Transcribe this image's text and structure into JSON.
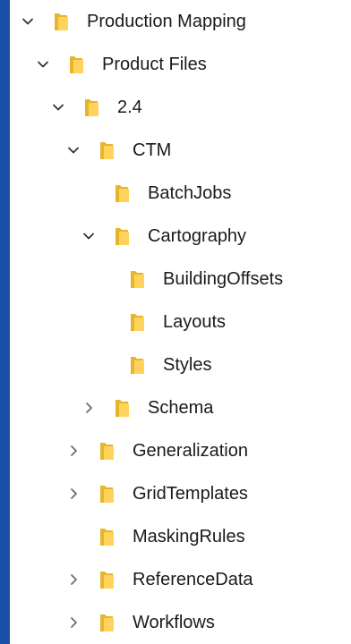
{
  "colors": {
    "backdrop": "#1a4fa8",
    "panel": "#ffffff",
    "text": "#1a1a1a",
    "chevron": "#6e6e6e",
    "folder_back": "#e6b52b",
    "folder_front": "#ffd35c"
  },
  "tree": {
    "items": [
      {
        "label": "Production Mapping",
        "level": 0,
        "state": "expanded"
      },
      {
        "label": "Product Files",
        "level": 1,
        "state": "expanded"
      },
      {
        "label": "2.4",
        "level": 2,
        "state": "expanded"
      },
      {
        "label": "CTM",
        "level": 3,
        "state": "expanded"
      },
      {
        "label": "BatchJobs",
        "level": 4,
        "state": "leaf"
      },
      {
        "label": "Cartography",
        "level": 4,
        "state": "expanded"
      },
      {
        "label": "BuildingOffsets",
        "level": 5,
        "state": "leaf"
      },
      {
        "label": "Layouts",
        "level": 5,
        "state": "leaf"
      },
      {
        "label": "Styles",
        "level": 5,
        "state": "leaf"
      },
      {
        "label": "Schema",
        "level": 4,
        "state": "collapsed"
      },
      {
        "label": "Generalization",
        "level": 3,
        "state": "collapsed"
      },
      {
        "label": "GridTemplates",
        "level": 3,
        "state": "collapsed"
      },
      {
        "label": "MaskingRules",
        "level": 3,
        "state": "leaf"
      },
      {
        "label": "ReferenceData",
        "level": 3,
        "state": "collapsed"
      },
      {
        "label": "Workflows",
        "level": 3,
        "state": "collapsed"
      }
    ]
  }
}
